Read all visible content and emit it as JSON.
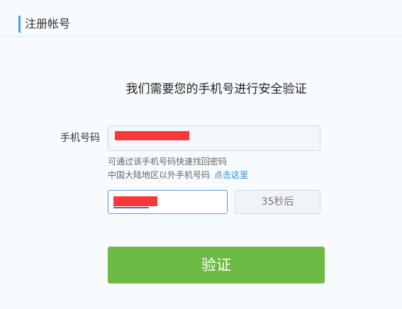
{
  "header": {
    "title": "注册帐号"
  },
  "heading": "我们需要您的手机号进行安全验证",
  "phone": {
    "label": "手机号码",
    "value_redacted": true
  },
  "hints": {
    "line1": "可通过该手机号码快速找回密码",
    "line2": "中国大陆地区以外手机号码",
    "link": "点击这里"
  },
  "code": {
    "value_redacted": true,
    "countdown": "35秒后"
  },
  "verify_button": "验证",
  "colors": {
    "accent_bar": "#4aa1d9",
    "link": "#2d8ed6",
    "button": "#6cb944",
    "redaction": "#f83838",
    "focus_border": "#5a9ee5"
  }
}
